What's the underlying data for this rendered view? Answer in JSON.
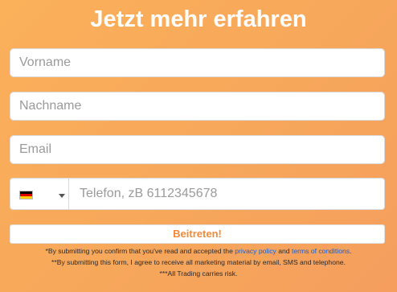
{
  "form": {
    "title": "Jetzt mehr erfahren",
    "first_name_placeholder": "Vorname",
    "last_name_placeholder": "Nachname",
    "email_placeholder": "Email",
    "phone": {
      "country_flag_icon": "germany-flag-icon",
      "flag_colors": [
        "#000000",
        "#dd0000",
        "#ffce00"
      ],
      "placeholder": "Telefon, zB 6112345678"
    },
    "submit_label": "Beitreten!"
  },
  "disclaimer": {
    "line1_prefix": "*By submitting you confirm that you've read and accepted the ",
    "privacy_link": "privacy policy",
    "line1_mid": " and ",
    "terms_link": "terms of conditions",
    "line1_suffix": ".",
    "line2": "**By submitting this form, I agree to receive all marketing material by email, SMS and telephone.",
    "line3": "***All Trading carries risk."
  },
  "colors": {
    "background_start": "#fbb05a",
    "background_end": "#f59e5e",
    "accent": "#f08a3a",
    "link": "#1a5fd0"
  }
}
